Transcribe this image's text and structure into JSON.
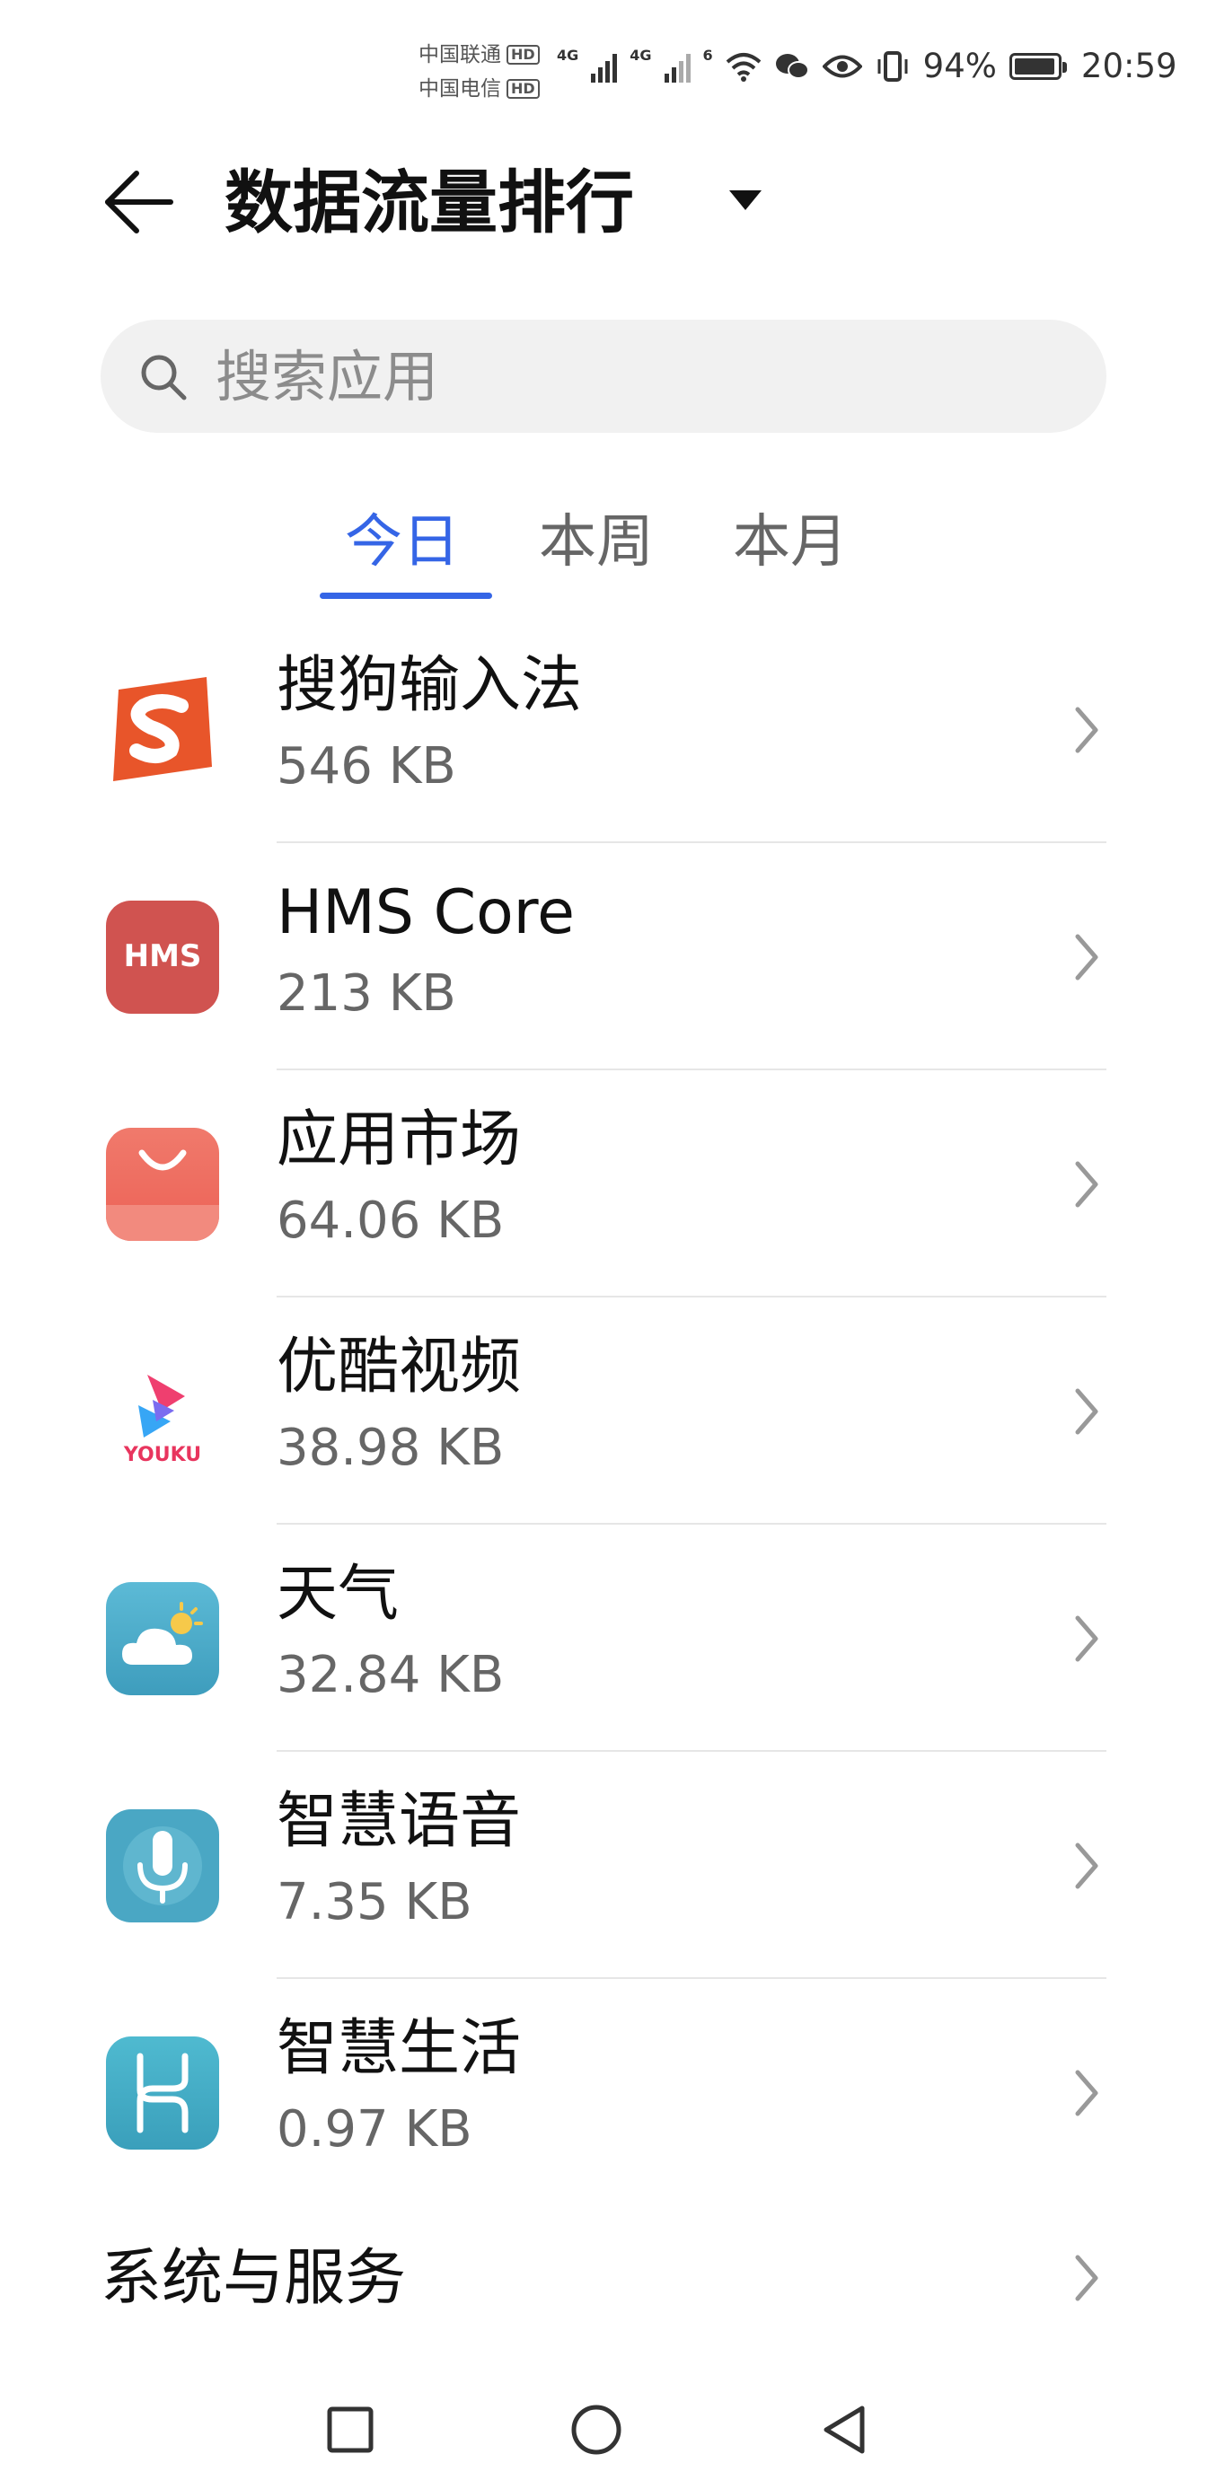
{
  "status_bar": {
    "carrier1": "中国联通",
    "carrier2": "中国电信",
    "hd": "HD",
    "net1": "4G",
    "net2": "4G",
    "wifi": "6",
    "battery": "94%",
    "time": "20:59"
  },
  "header": {
    "title": "数据流量排行"
  },
  "search": {
    "placeholder": "搜索应用"
  },
  "tabs": [
    {
      "label": "今日",
      "active": true
    },
    {
      "label": "本周",
      "active": false
    },
    {
      "label": "本月",
      "active": false
    }
  ],
  "apps": [
    {
      "name": "搜狗输入法",
      "size": "546 KB",
      "icon": "sogou-icon"
    },
    {
      "name": "HMS Core",
      "size": "213 KB",
      "icon": "hms-core-icon",
      "icon_text": "HMS"
    },
    {
      "name": "应用市场",
      "size": "64.06 KB",
      "icon": "app-market-icon"
    },
    {
      "name": "优酷视频",
      "size": "38.98 KB",
      "icon": "youku-icon",
      "icon_text": "YOUKU"
    },
    {
      "name": "天气",
      "size": "32.84 KB",
      "icon": "weather-icon"
    },
    {
      "name": "智慧语音",
      "size": "7.35 KB",
      "icon": "voice-assistant-icon"
    },
    {
      "name": "智慧生活",
      "size": "0.97 KB",
      "icon": "smart-life-icon"
    }
  ],
  "system": {
    "label": "系统与服务"
  },
  "colors": {
    "accent": "#3565e6",
    "sogou": "#e8552a",
    "hms": "#d05350",
    "market": "#ef6b5e",
    "weather": "#49a9c8",
    "voice": "#4aa7c4",
    "smart_life": "#45b0c6"
  }
}
